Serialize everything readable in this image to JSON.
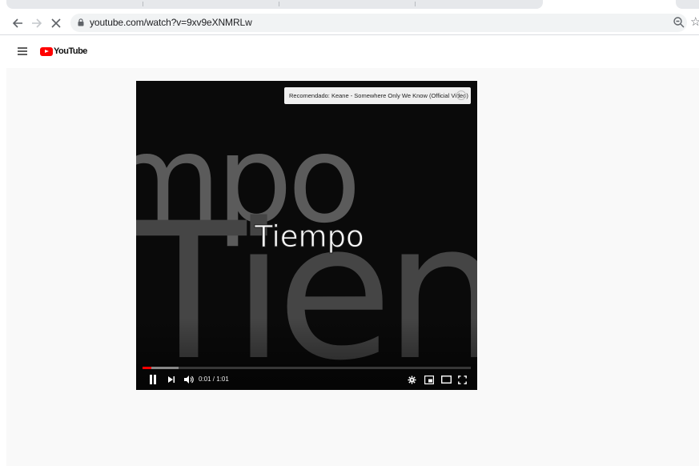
{
  "browser": {
    "url": "youtube.com/watch?v=9xv9eXNMRLw",
    "back_icon": "arrow-left-icon",
    "forward_icon": "arrow-right-icon",
    "stop_icon": "close-icon"
  },
  "youtube": {
    "logo_text": "YouTube"
  },
  "player": {
    "recommendation": "Recomendado: Keane - Somewhere Only We Know (Official Video)",
    "info_glyph": "i",
    "video_title_text": "Tiempo",
    "time": "0:01 / 1:01",
    "progress_played_fraction": 0.016,
    "state": "playing"
  },
  "colors": {
    "yt_red": "#ff0000",
    "progress_red": "#ff0000"
  }
}
